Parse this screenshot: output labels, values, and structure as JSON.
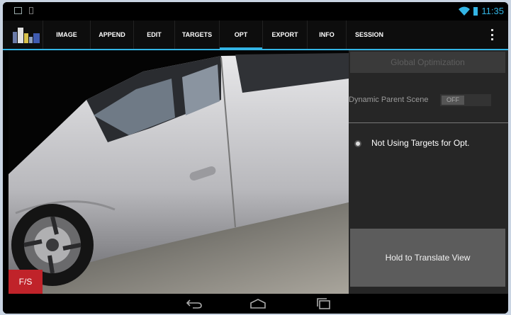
{
  "status_bar": {
    "time": "11:35"
  },
  "action_bar": {
    "tabs": [
      {
        "label": "IMAGE"
      },
      {
        "label": "APPEND"
      },
      {
        "label": "EDIT"
      },
      {
        "label": "TARGETS"
      },
      {
        "label": "OPT",
        "active": true
      },
      {
        "label": "EXPORT"
      },
      {
        "label": "INFO"
      },
      {
        "label": "SESSION"
      }
    ],
    "overflow_icon": "overflow-menu-icon"
  },
  "viewport": {
    "content": "3D point cloud of car",
    "fs_button_label": "F/S"
  },
  "panel": {
    "global_optimization_label": "Global Optimization",
    "dynamic_parent_scene_label": "Dynamic Parent Scene",
    "dynamic_parent_scene_toggle": "OFF",
    "targets_status": "Not Using Targets for Opt.",
    "hold_button_label": "Hold to Translate View"
  },
  "nav_bar": {
    "icons": [
      "back-icon",
      "home-icon",
      "recent-apps-icon"
    ]
  },
  "colors": {
    "accent": "#33b5e5",
    "fs_button": "#c0232a",
    "panel_bg": "#262626"
  }
}
